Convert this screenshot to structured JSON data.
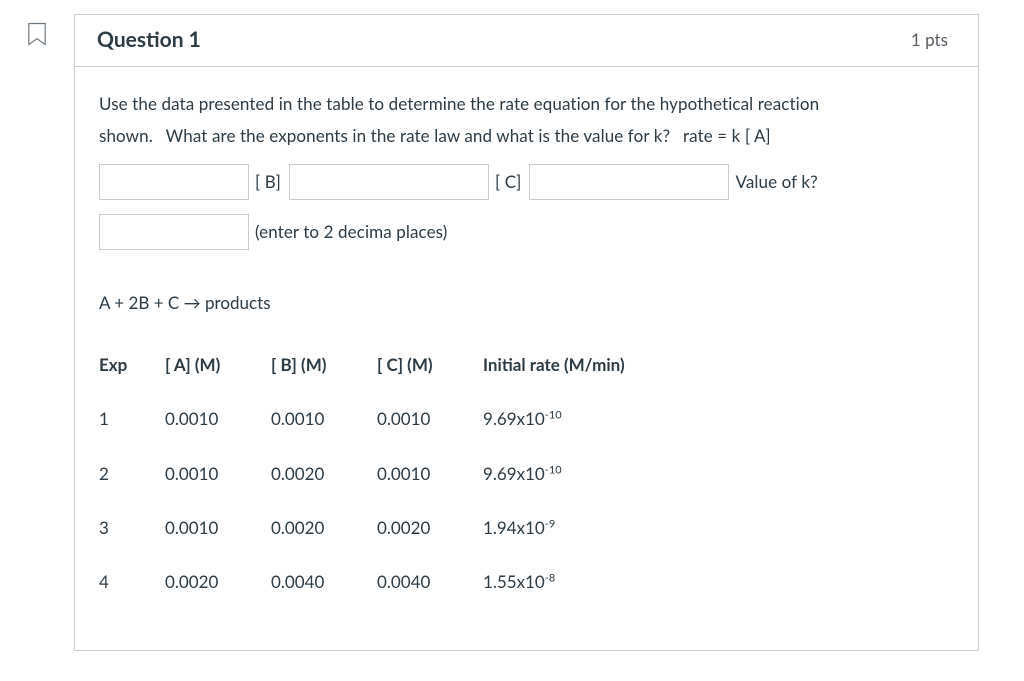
{
  "header": {
    "title": "Question 1",
    "points": "1 pts"
  },
  "prompt_line1": "Use the data presented in the table to determine the rate equation for the hypothetical reaction",
  "prompt_line2_pre": "shown. What are the exponents in the rate law and what is the value for k? rate = k [ A]",
  "labels": {
    "b": "[ B]",
    "c": "[ C]",
    "k": "Value of k?",
    "precision": "(enter to 2 decima places)"
  },
  "reaction": "A + 2B + C → products",
  "table": {
    "headers": [
      "Exp",
      "[ A] (M)",
      "[ B] (M)",
      "[ C] (M)",
      "Initial rate (M/min)"
    ],
    "rows": [
      {
        "exp": "1",
        "a": "0.0010",
        "b": "0.0010",
        "c": "0.0010",
        "rate_html": "9.69x10<sup>-10</sup>"
      },
      {
        "exp": "2",
        "a": "0.0010",
        "b": "0.0020",
        "c": "0.0010",
        "rate_html": "9.69x10<sup>-10</sup>"
      },
      {
        "exp": "3",
        "a": "0.0010",
        "b": "0.0020",
        "c": "0.0020",
        "rate_html": "1.94x10<sup>-9</sup>"
      },
      {
        "exp": "4",
        "a": "0.0020",
        "b": "0.0040",
        "c": "0.0040",
        "rate_html": "1.55x10<sup>-8</sup>"
      }
    ]
  }
}
